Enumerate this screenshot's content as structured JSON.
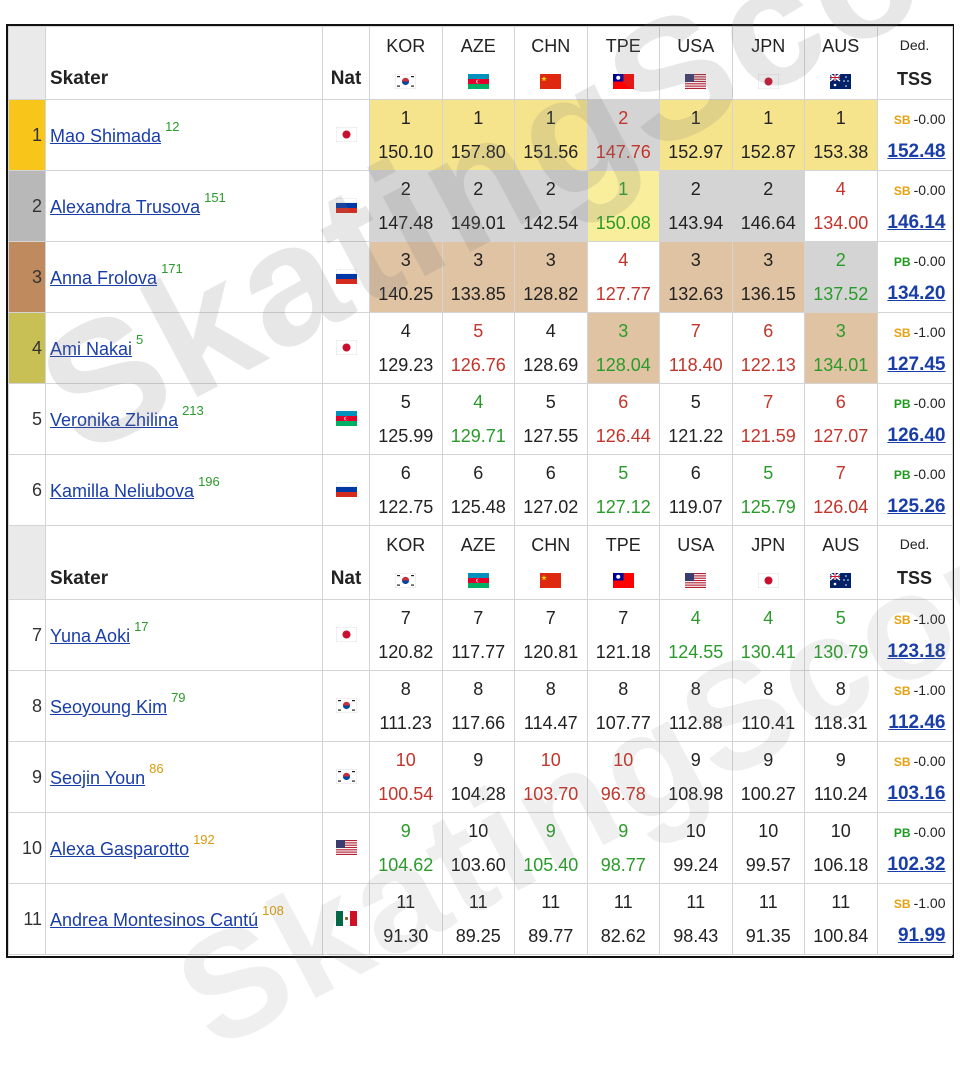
{
  "header": {
    "skater_label": "Skater",
    "nat_label": "Nat",
    "ded_label": "Ded.",
    "tss_label": "TSS",
    "judges": [
      {
        "code": "KOR",
        "flag": "kor"
      },
      {
        "code": "AZE",
        "flag": "aze"
      },
      {
        "code": "CHN",
        "flag": "chn"
      },
      {
        "code": "TPE",
        "flag": "tpe"
      },
      {
        "code": "USA",
        "flag": "usa"
      },
      {
        "code": "JPN",
        "flag": "jpn"
      },
      {
        "code": "AUS",
        "flag": "aus"
      }
    ]
  },
  "skaters": [
    {
      "rank": "1",
      "name": "Mao Shimada",
      "sup": "12",
      "sup_color": "green",
      "nat": "jpn",
      "badge": "SB",
      "ded": "-0.00",
      "tss": "152.48",
      "scores": [
        {
          "p": "1",
          "s": "150.10",
          "c": "blk",
          "bg": "gold"
        },
        {
          "p": "1",
          "s": "157.80",
          "c": "blk",
          "bg": "gold"
        },
        {
          "p": "1",
          "s": "151.56",
          "c": "blk",
          "bg": "gold"
        },
        {
          "p": "2",
          "s": "147.76",
          "c": "red",
          "bg": "silver"
        },
        {
          "p": "1",
          "s": "152.97",
          "c": "blk",
          "bg": "gold"
        },
        {
          "p": "1",
          "s": "152.87",
          "c": "blk",
          "bg": "gold"
        },
        {
          "p": "1",
          "s": "153.38",
          "c": "blk",
          "bg": "gold"
        }
      ]
    },
    {
      "rank": "2",
      "name": "Alexandra Trusova",
      "sup": "151",
      "sup_color": "green",
      "nat": "rus",
      "badge": "SB",
      "ded": "-0.00",
      "tss": "146.14",
      "scores": [
        {
          "p": "2",
          "s": "147.48",
          "c": "blk",
          "bg": "silver"
        },
        {
          "p": "2",
          "s": "149.01",
          "c": "blk",
          "bg": "silver"
        },
        {
          "p": "2",
          "s": "142.54",
          "c": "blk",
          "bg": "silver"
        },
        {
          "p": "1",
          "s": "150.08",
          "c": "green",
          "bg": "sgold"
        },
        {
          "p": "2",
          "s": "143.94",
          "c": "blk",
          "bg": "silver"
        },
        {
          "p": "2",
          "s": "146.64",
          "c": "blk",
          "bg": "silver"
        },
        {
          "p": "4",
          "s": "134.00",
          "c": "red",
          "bg": ""
        }
      ]
    },
    {
      "rank": "3",
      "name": "Anna Frolova",
      "sup": "171",
      "sup_color": "green",
      "nat": "rus",
      "badge": "PB",
      "ded": "-0.00",
      "tss": "134.20",
      "scores": [
        {
          "p": "3",
          "s": "140.25",
          "c": "blk",
          "bg": "bronze"
        },
        {
          "p": "3",
          "s": "133.85",
          "c": "blk",
          "bg": "bronze"
        },
        {
          "p": "3",
          "s": "128.82",
          "c": "blk",
          "bg": "bronze"
        },
        {
          "p": "4",
          "s": "127.77",
          "c": "red",
          "bg": ""
        },
        {
          "p": "3",
          "s": "132.63",
          "c": "blk",
          "bg": "bronze"
        },
        {
          "p": "3",
          "s": "136.15",
          "c": "blk",
          "bg": "bronze"
        },
        {
          "p": "2",
          "s": "137.52",
          "c": "green",
          "bg": "silver"
        }
      ]
    },
    {
      "rank": "4",
      "name": "Ami Nakai",
      "sup": "5",
      "sup_color": "green",
      "nat": "jpn",
      "badge": "SB",
      "ded": "-1.00",
      "tss": "127.45",
      "scores": [
        {
          "p": "4",
          "s": "129.23",
          "c": "blk",
          "bg": ""
        },
        {
          "p": "5",
          "s": "126.76",
          "c": "red",
          "bg": ""
        },
        {
          "p": "4",
          "s": "128.69",
          "c": "blk",
          "bg": ""
        },
        {
          "p": "3",
          "s": "128.04",
          "c": "green",
          "bg": "bronze"
        },
        {
          "p": "7",
          "s": "118.40",
          "c": "red",
          "bg": ""
        },
        {
          "p": "6",
          "s": "122.13",
          "c": "red",
          "bg": ""
        },
        {
          "p": "3",
          "s": "134.01",
          "c": "green",
          "bg": "bronze"
        }
      ]
    },
    {
      "rank": "5",
      "name": "Veronika Zhilina",
      "sup": "213",
      "sup_color": "green",
      "nat": "aze",
      "badge": "PB",
      "ded": "-0.00",
      "tss": "126.40",
      "scores": [
        {
          "p": "5",
          "s": "125.99",
          "c": "blk",
          "bg": ""
        },
        {
          "p": "4",
          "s": "129.71",
          "c": "green",
          "bg": ""
        },
        {
          "p": "5",
          "s": "127.55",
          "c": "blk",
          "bg": ""
        },
        {
          "p": "6",
          "s": "126.44",
          "c": "red",
          "bg": ""
        },
        {
          "p": "5",
          "s": "121.22",
          "c": "blk",
          "bg": ""
        },
        {
          "p": "7",
          "s": "121.59",
          "c": "red",
          "bg": ""
        },
        {
          "p": "6",
          "s": "127.07",
          "c": "red",
          "bg": ""
        }
      ]
    },
    {
      "rank": "6",
      "name": "Kamilla Neliubova",
      "sup": "196",
      "sup_color": "green",
      "nat": "rus",
      "badge": "PB",
      "ded": "-0.00",
      "tss": "125.26",
      "scores": [
        {
          "p": "6",
          "s": "122.75",
          "c": "blk",
          "bg": ""
        },
        {
          "p": "6",
          "s": "125.48",
          "c": "blk",
          "bg": ""
        },
        {
          "p": "6",
          "s": "127.02",
          "c": "blk",
          "bg": ""
        },
        {
          "p": "5",
          "s": "127.12",
          "c": "green",
          "bg": ""
        },
        {
          "p": "6",
          "s": "119.07",
          "c": "blk",
          "bg": ""
        },
        {
          "p": "5",
          "s": "125.79",
          "c": "green",
          "bg": ""
        },
        {
          "p": "7",
          "s": "126.04",
          "c": "red",
          "bg": ""
        }
      ]
    },
    {
      "rank": "7",
      "name": "Yuna Aoki",
      "sup": "17",
      "sup_color": "green",
      "nat": "jpn",
      "badge": "SB",
      "ded": "-1.00",
      "tss": "123.18",
      "scores": [
        {
          "p": "7",
          "s": "120.82",
          "c": "blk",
          "bg": ""
        },
        {
          "p": "7",
          "s": "117.77",
          "c": "blk",
          "bg": ""
        },
        {
          "p": "7",
          "s": "120.81",
          "c": "blk",
          "bg": ""
        },
        {
          "p": "7",
          "s": "121.18",
          "c": "blk",
          "bg": ""
        },
        {
          "p": "4",
          "s": "124.55",
          "c": "green",
          "bg": ""
        },
        {
          "p": "4",
          "s": "130.41",
          "c": "green",
          "bg": ""
        },
        {
          "p": "5",
          "s": "130.79",
          "c": "green",
          "bg": ""
        }
      ]
    },
    {
      "rank": "8",
      "name": "Seoyoung Kim",
      "sup": "79",
      "sup_color": "green",
      "nat": "kor",
      "badge": "SB",
      "ded": "-1.00",
      "tss": "112.46",
      "scores": [
        {
          "p": "8",
          "s": "111.23",
          "c": "blk",
          "bg": ""
        },
        {
          "p": "8",
          "s": "117.66",
          "c": "blk",
          "bg": ""
        },
        {
          "p": "8",
          "s": "114.47",
          "c": "blk",
          "bg": ""
        },
        {
          "p": "8",
          "s": "107.77",
          "c": "blk",
          "bg": ""
        },
        {
          "p": "8",
          "s": "112.88",
          "c": "blk",
          "bg": ""
        },
        {
          "p": "8",
          "s": "110.41",
          "c": "blk",
          "bg": ""
        },
        {
          "p": "8",
          "s": "118.31",
          "c": "blk",
          "bg": ""
        }
      ]
    },
    {
      "rank": "9",
      "name": "Seojin Youn",
      "sup": "86",
      "sup_color": "orange",
      "nat": "kor",
      "badge": "SB",
      "ded": "-0.00",
      "tss": "103.16",
      "scores": [
        {
          "p": "10",
          "s": "100.54",
          "c": "red",
          "bg": ""
        },
        {
          "p": "9",
          "s": "104.28",
          "c": "blk",
          "bg": ""
        },
        {
          "p": "10",
          "s": "103.70",
          "c": "red",
          "bg": ""
        },
        {
          "p": "10",
          "s": "96.78",
          "c": "red",
          "bg": ""
        },
        {
          "p": "9",
          "s": "108.98",
          "c": "blk",
          "bg": ""
        },
        {
          "p": "9",
          "s": "100.27",
          "c": "blk",
          "bg": ""
        },
        {
          "p": "9",
          "s": "110.24",
          "c": "blk",
          "bg": ""
        }
      ]
    },
    {
      "rank": "10",
      "name": "Alexa Gasparotto",
      "sup": "192",
      "sup_color": "orange",
      "nat": "usa",
      "badge": "PB",
      "ded": "-0.00",
      "tss": "102.32",
      "scores": [
        {
          "p": "9",
          "s": "104.62",
          "c": "green",
          "bg": ""
        },
        {
          "p": "10",
          "s": "103.60",
          "c": "blk",
          "bg": ""
        },
        {
          "p": "9",
          "s": "105.40",
          "c": "green",
          "bg": ""
        },
        {
          "p": "9",
          "s": "98.77",
          "c": "green",
          "bg": ""
        },
        {
          "p": "10",
          "s": "99.24",
          "c": "blk",
          "bg": ""
        },
        {
          "p": "10",
          "s": "99.57",
          "c": "blk",
          "bg": ""
        },
        {
          "p": "10",
          "s": "106.18",
          "c": "blk",
          "bg": ""
        }
      ]
    },
    {
      "rank": "11",
      "name": "Andrea Montesinos Cantú",
      "sup": "108",
      "sup_color": "orange",
      "nat": "mex",
      "badge": "SB",
      "ded": "-1.00",
      "tss": "91.99",
      "scores": [
        {
          "p": "11",
          "s": "91.30",
          "c": "blk",
          "bg": ""
        },
        {
          "p": "11",
          "s": "89.25",
          "c": "blk",
          "bg": ""
        },
        {
          "p": "11",
          "s": "89.77",
          "c": "blk",
          "bg": ""
        },
        {
          "p": "11",
          "s": "82.62",
          "c": "blk",
          "bg": ""
        },
        {
          "p": "11",
          "s": "98.43",
          "c": "blk",
          "bg": ""
        },
        {
          "p": "11",
          "s": "91.35",
          "c": "blk",
          "bg": ""
        },
        {
          "p": "11",
          "s": "100.84",
          "c": "blk",
          "bg": ""
        }
      ]
    }
  ],
  "repeat_header_before_index": 6,
  "watermark": "SkatingScores.com"
}
